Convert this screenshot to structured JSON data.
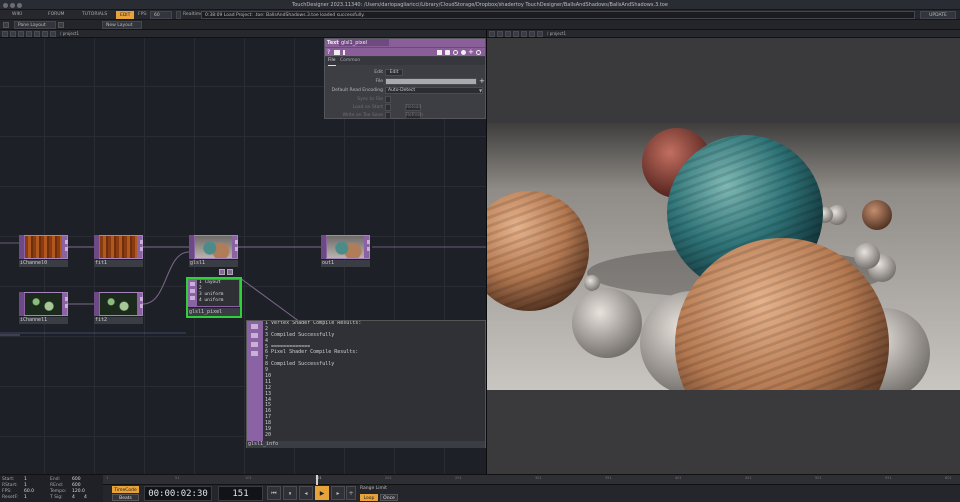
{
  "window": {
    "title": "TouchDesigner 2023.11340: /Users/dariopagliaricci/Library/CloudStorage/Dropbox/shadertoy TouchDesigner/BallsAndShadows/BallsAndShadows.3.toe"
  },
  "menubar": {
    "wiki": "WIKI",
    "forum": "FORUM",
    "tutorials": "TUTORIALS",
    "edit": "EDIT",
    "fps_label": "FPS:",
    "fps_value": "60",
    "realtime": "Realtime",
    "status": "0:38:09 Load Project: .toe: BallsAndShadows.3.toe loaded successfully.",
    "update": "UPDATE"
  },
  "layoutbar": {
    "pane_layout": "Pane Layout",
    "new_layout": "New Layout"
  },
  "network_path": "/ project1",
  "viewer_path": "/ project1",
  "nodes": {
    "ichannel0": "iChannel0",
    "fit1": "fit1",
    "glsl1": "glsl1",
    "out1": "out1",
    "ichannel1": "iChannel1",
    "fit2": "fit2",
    "glsl1_pixel": "glsl1_pixel",
    "glsl1_info": "glsl1_info"
  },
  "pixel_node_lines": [
    "1  layout",
    "2",
    "3  uniform",
    "4  uniform"
  ],
  "param": {
    "type": "Text",
    "name": "glsl1_pixel",
    "tabs": [
      "File",
      "Common"
    ],
    "rows": [
      {
        "label": "Edit",
        "value": "Edit",
        "dim": false
      },
      {
        "label": "File",
        "value": "",
        "dim": false
      },
      {
        "label": "Default Read Encoding",
        "value": "Auto-Detect",
        "dim": false
      },
      {
        "label": "Sync to File",
        "value": "",
        "dim": true
      },
      {
        "label": "Load on Start",
        "value": "Reload",
        "dim": true
      },
      {
        "label": "Write on Toe Save",
        "value": "Refresh",
        "dim": true
      }
    ]
  },
  "info_lines": [
    "1  Vertex Shader Compile Results:",
    "2",
    "3  Compiled Successfully",
    "4",
    "5  =============",
    "6  Pixel Shader Compile Results:",
    "7",
    "8  Compiled Successfully",
    "9",
    "10",
    "11",
    "12",
    "13",
    "14",
    "15",
    "16",
    "17",
    "18",
    "19",
    "20"
  ],
  "timeline": {
    "start_label": "Start:",
    "start": "1",
    "end_label": "End:",
    "end": "600",
    "rstart_label": "RStart:",
    "rstart": "1",
    "rend_label": "REnd:",
    "rend": "600",
    "fps_label": "FPS:",
    "fps": "60.0",
    "tempo_label": "Tempo:",
    "tempo": "120.0",
    "reset_label": "ResetF:",
    "reset": "1",
    "tsig_label": "T Sig:",
    "tsig_a": "4",
    "tsig_b": "4",
    "timecode_btn": "TimeCode",
    "beats_btn": "Beats",
    "timecode": "00:00:02:30",
    "frame": "151",
    "range_limit": "Range Limit",
    "loop": "Loop",
    "once": "Once",
    "ruler_ticks": [
      "1",
      "51",
      "101",
      "151",
      "201",
      "251",
      "301",
      "351",
      "401",
      "451",
      "501",
      "551",
      "601"
    ]
  },
  "colors": {
    "accent": "#8b62a3",
    "selected": "#2fcf3a",
    "play": "#e8a23a"
  }
}
